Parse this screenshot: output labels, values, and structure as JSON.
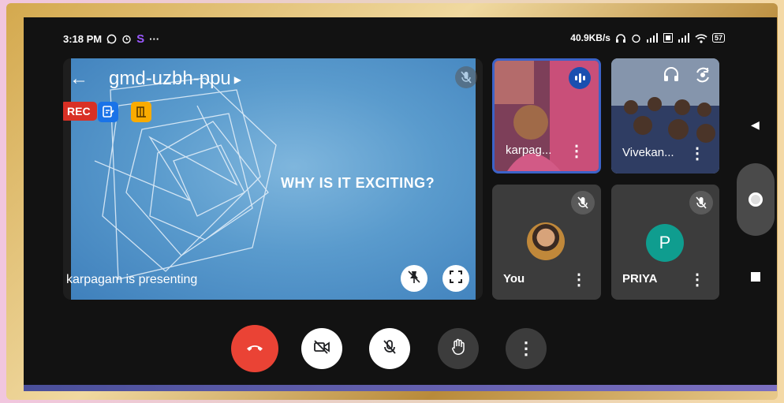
{
  "status_bar": {
    "time": "3:18 PM",
    "network_speed": "40.9KB/s",
    "battery": "57",
    "more": "···",
    "app_letter": "S"
  },
  "meeting": {
    "code": "gmd-uzbh-ppu",
    "rec_label": "REC",
    "presenting_text": "karpagam is presenting",
    "slide_title": "WHY IS IT EXCITING?"
  },
  "participants": [
    {
      "name": "karpag...",
      "state": "speaking"
    },
    {
      "name": "Vivekan...",
      "state": "video"
    },
    {
      "name": "You",
      "state": "muted"
    },
    {
      "name": "PRIYA",
      "state": "muted",
      "initial": "P",
      "avatar_color": "#0f9d8f"
    }
  ],
  "controls": {
    "more_label": "⋮"
  },
  "icons": {
    "back": "←",
    "nav_back": "◀"
  }
}
